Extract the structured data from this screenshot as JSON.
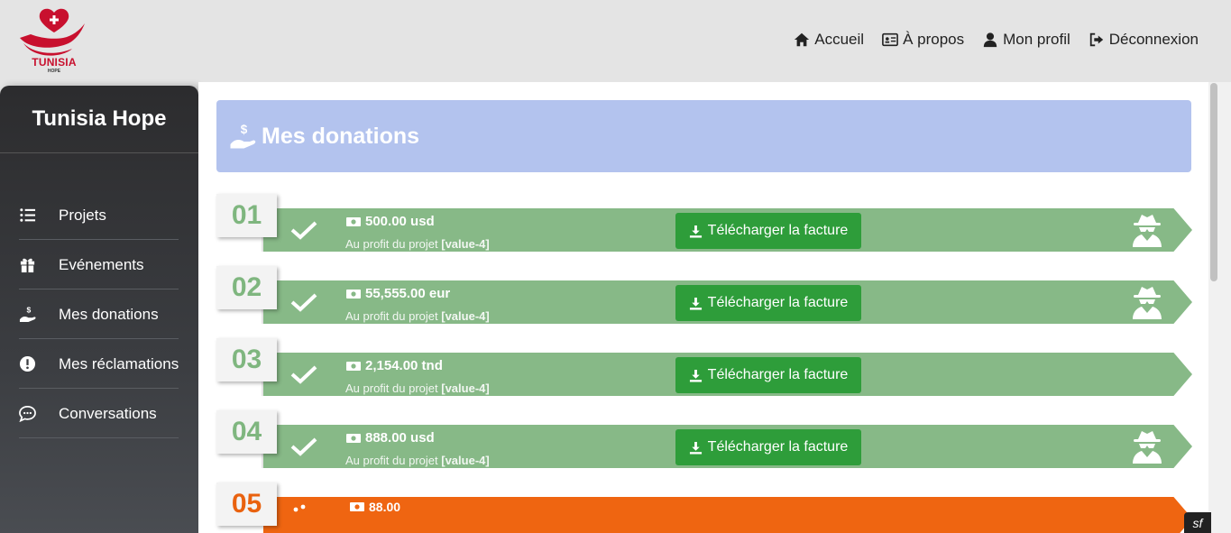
{
  "logo": {
    "brand": "TUNISIA",
    "sub": "HOPE"
  },
  "nav": [
    {
      "label": "Accueil",
      "icon": "home-icon"
    },
    {
      "label": "À propos",
      "icon": "id-card-icon"
    },
    {
      "label": "Mon profil",
      "icon": "user-icon"
    },
    {
      "label": "Déconnexion",
      "icon": "logout-icon"
    }
  ],
  "sidebar": {
    "title": "Tunisia Hope",
    "items": [
      {
        "label": "Projets",
        "icon": "list-icon"
      },
      {
        "label": "Evénements",
        "icon": "gift-icon"
      },
      {
        "label": "Mes donations",
        "icon": "hand-donate-icon"
      },
      {
        "label": "Mes réclamations",
        "icon": "exclamation-icon"
      },
      {
        "label": "Conversations",
        "icon": "chat-icon"
      }
    ]
  },
  "main": {
    "title": "Mes donations",
    "profit_prefix": "Au profit du projet",
    "download_label": "Télécharger la facture",
    "donations": [
      {
        "number": "01",
        "amount": "500.00 usd",
        "project": "[value-4]",
        "status": "completed",
        "anonymous": true
      },
      {
        "number": "02",
        "amount": "55,555.00 eur",
        "project": "[value-4]",
        "status": "completed",
        "anonymous": true
      },
      {
        "number": "03",
        "amount": "2,154.00 tnd",
        "project": "[value-4]",
        "status": "completed",
        "anonymous": false
      },
      {
        "number": "04",
        "amount": "888.00 usd",
        "project": "[value-4]",
        "status": "completed",
        "anonymous": true
      },
      {
        "number": "05",
        "amount": "88.00",
        "project": "",
        "status": "pending",
        "anonymous": false
      }
    ]
  },
  "colors": {
    "accent_header": "#b3c3ee",
    "band_completed": "#87b987",
    "band_pending": "#ef6511",
    "button_green": "#2e9d3a",
    "brand_red": "#c8102e"
  }
}
